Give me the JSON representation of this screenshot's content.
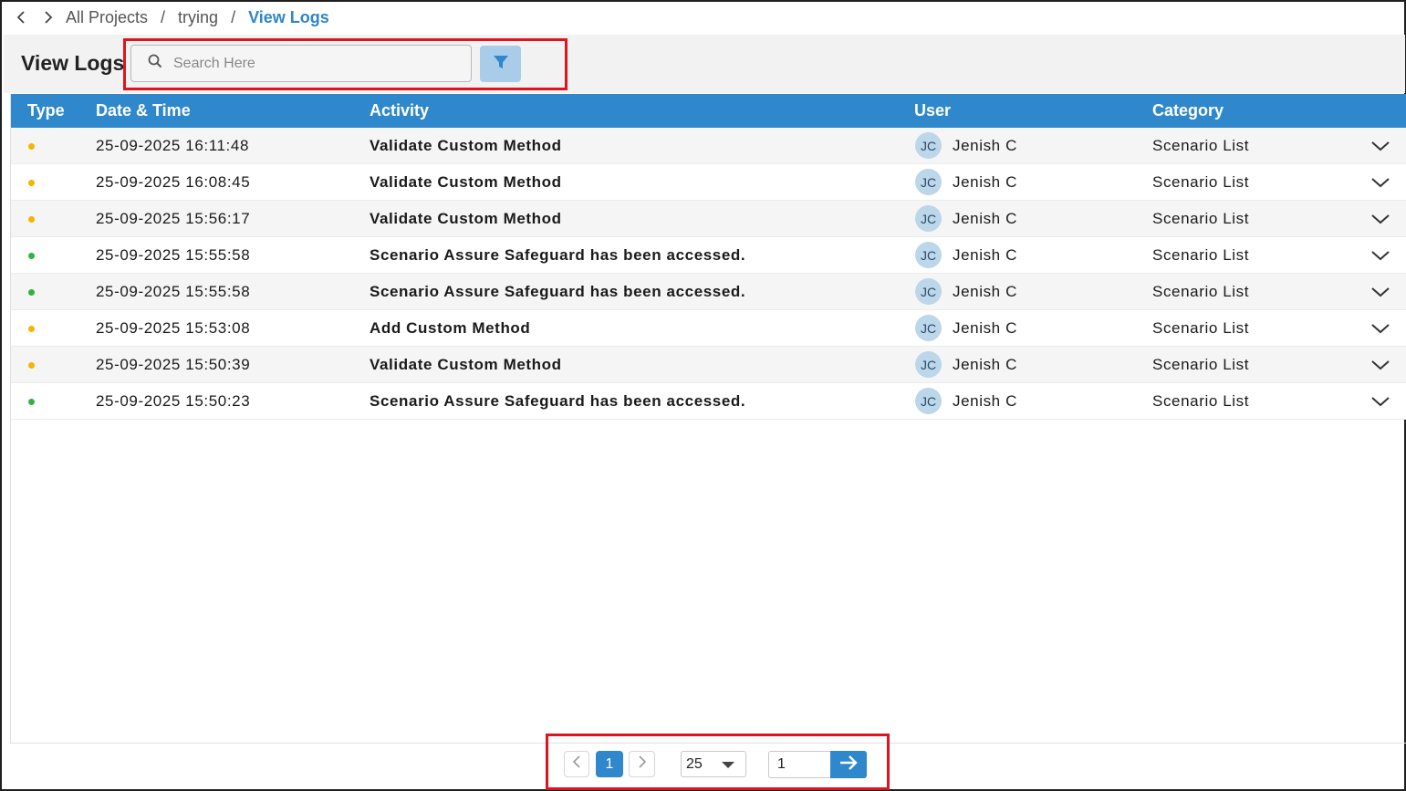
{
  "breadcrumb": {
    "items": [
      "All Projects",
      "trying"
    ],
    "current": "View Logs",
    "separator": "/"
  },
  "page": {
    "title": "View Logs"
  },
  "search": {
    "placeholder": "Search Here",
    "value": ""
  },
  "table": {
    "headers": {
      "type": "Type",
      "datetime": "Date & Time",
      "activity": "Activity",
      "user": "User",
      "category": "Category"
    },
    "rows": [
      {
        "type_color": "#f5b400",
        "datetime": "25-09-2025 16:11:48",
        "activity": "Validate Custom Method",
        "initials": "JC",
        "user": "Jenish C",
        "category": "Scenario List"
      },
      {
        "type_color": "#f5b400",
        "datetime": "25-09-2025 16:08:45",
        "activity": "Validate Custom Method",
        "initials": "JC",
        "user": "Jenish C",
        "category": "Scenario List"
      },
      {
        "type_color": "#f5b400",
        "datetime": "25-09-2025 15:56:17",
        "activity": "Validate Custom Method",
        "initials": "JC",
        "user": "Jenish C",
        "category": "Scenario List"
      },
      {
        "type_color": "#2fb344",
        "datetime": "25-09-2025 15:55:58",
        "activity": "Scenario Assure Safeguard has been accessed.",
        "initials": "JC",
        "user": "Jenish C",
        "category": "Scenario List"
      },
      {
        "type_color": "#2fb344",
        "datetime": "25-09-2025 15:55:58",
        "activity": "Scenario Assure Safeguard has been accessed.",
        "initials": "JC",
        "user": "Jenish C",
        "category": "Scenario List"
      },
      {
        "type_color": "#f5b400",
        "datetime": "25-09-2025 15:53:08",
        "activity": "Add Custom Method",
        "initials": "JC",
        "user": "Jenish C",
        "category": "Scenario List"
      },
      {
        "type_color": "#f5b400",
        "datetime": "25-09-2025 15:50:39",
        "activity": "Validate Custom Method",
        "initials": "JC",
        "user": "Jenish C",
        "category": "Scenario List"
      },
      {
        "type_color": "#2fb344",
        "datetime": "25-09-2025 15:50:23",
        "activity": "Scenario Assure Safeguard has been accessed.",
        "initials": "JC",
        "user": "Jenish C",
        "category": "Scenario List"
      }
    ]
  },
  "pagination": {
    "current_page": "1",
    "page_size": "25",
    "goto_value": "1"
  },
  "colors": {
    "accent": "#2f88cb",
    "highlight": "#e0141e",
    "warning_dot": "#f5b400",
    "success_dot": "#2fb344"
  },
  "icons": {
    "back": "chevron-left-icon",
    "forward": "chevron-right-icon",
    "search": "search-icon",
    "filter": "filter-icon",
    "expand": "chevron-down-icon",
    "go": "arrow-right-icon"
  }
}
